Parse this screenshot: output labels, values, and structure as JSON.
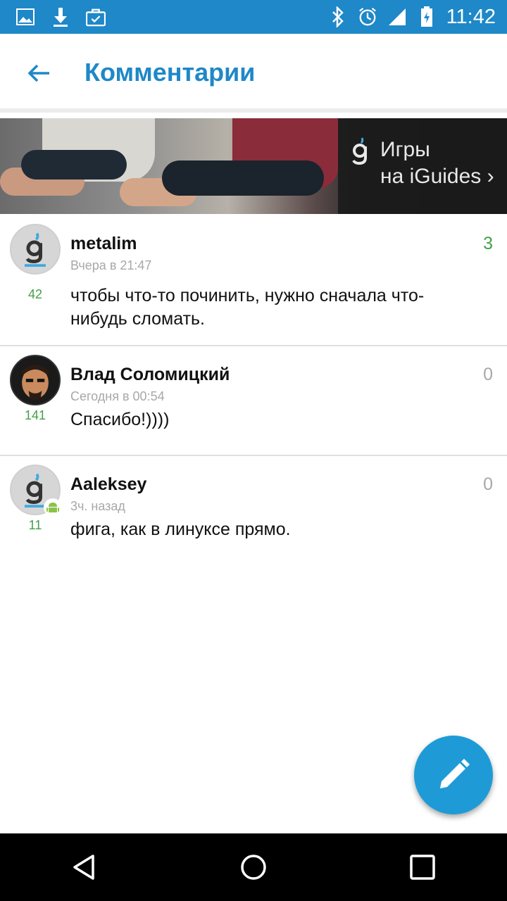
{
  "status_bar": {
    "time": "11:42",
    "left_icons": [
      "image-icon",
      "download-icon",
      "briefcase-check-icon"
    ],
    "right_icons": [
      "bluetooth-icon",
      "alarm-icon",
      "signal-icon",
      "battery-icon"
    ],
    "background": "#1e88c8"
  },
  "app_bar": {
    "title": "Комментарии",
    "back_icon": "arrow-back-icon",
    "accent": "#1e88c8"
  },
  "banner": {
    "line1": "Игры",
    "line2": "на iGuides ›"
  },
  "comments": [
    {
      "author": "metalim",
      "time": "Вчера в 21:47",
      "rating": "3",
      "user_score": "42",
      "text": "чтобы что-то починить, нужно сначала что-нибудь сломать.",
      "avatar": "iguides-logo"
    },
    {
      "author": "Влад Соломицкий",
      "time": "Сегодня в 00:54",
      "rating": "0",
      "user_score": "141",
      "text": "Спасибо!))))",
      "avatar": "photo"
    },
    {
      "author": "Aaleksey",
      "time": "3ч. назад",
      "rating": "0",
      "user_score": "11",
      "text": "фига, как в линуксе прямо.",
      "avatar": "iguides-logo",
      "badge": "android-icon"
    }
  ],
  "fab": {
    "icon": "pencil-icon",
    "color": "#1e9bd7"
  },
  "nav_bar": {
    "buttons": [
      "back-triangle-icon",
      "home-circle-icon",
      "recents-square-icon"
    ]
  },
  "colors": {
    "positive": "#43a047",
    "muted": "#a8a8a8"
  }
}
